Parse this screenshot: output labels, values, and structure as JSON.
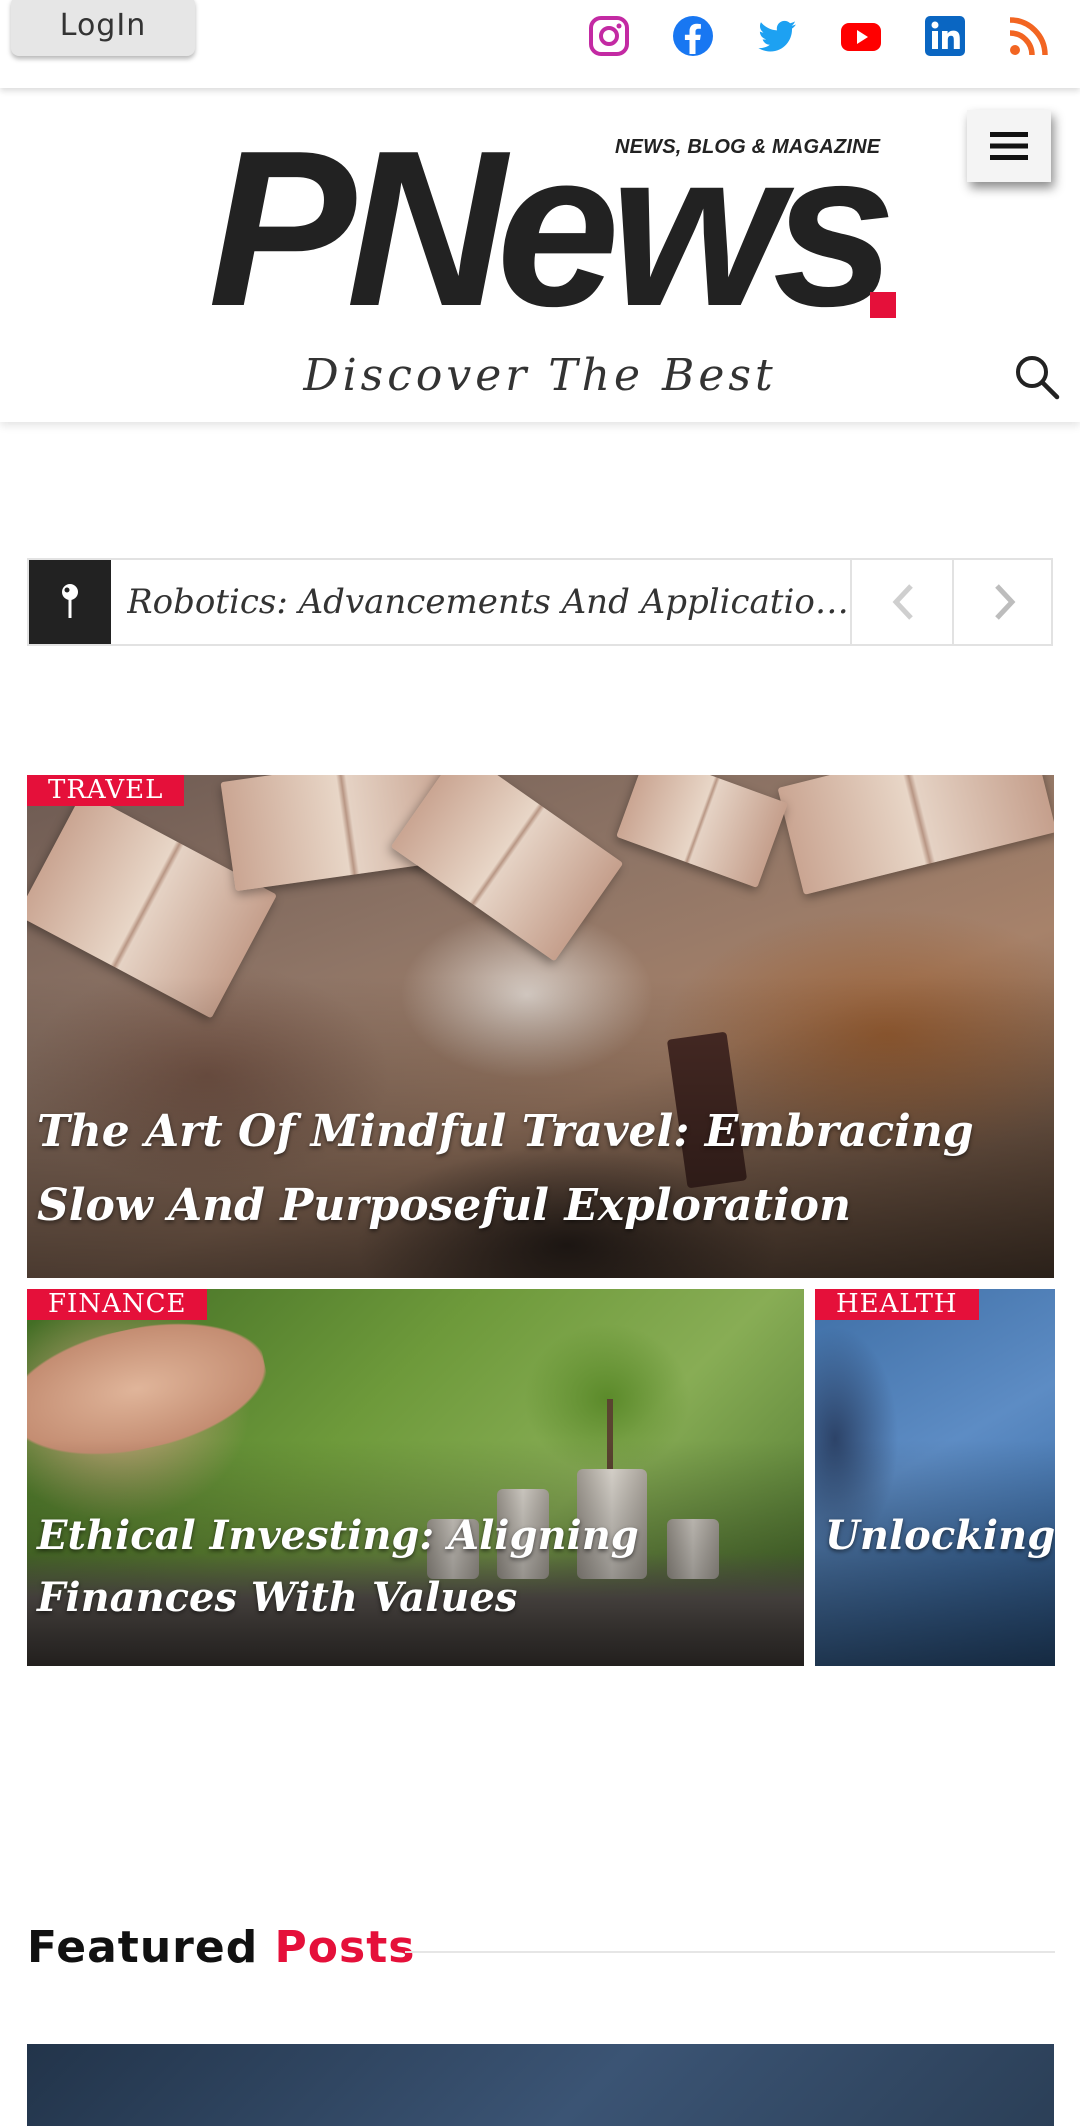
{
  "topbar": {
    "login_label": "LogIn",
    "social": [
      {
        "name": "instagram",
        "color": "#c32aa3"
      },
      {
        "name": "facebook",
        "color": "#1877f2"
      },
      {
        "name": "twitter",
        "color": "#1da1f2"
      },
      {
        "name": "youtube",
        "color": "#ff0000"
      },
      {
        "name": "linkedin",
        "color": "#0a66c2"
      },
      {
        "name": "rss",
        "color": "#f26522"
      }
    ]
  },
  "header": {
    "tagline": "NEWS, BLOG & MAGAZINE",
    "logo_text": "PNews",
    "slogan": "Discover The Best",
    "accent_color": "#e5103a"
  },
  "ticker": {
    "text": "Robotics: Advancements And Applications"
  },
  "posts": [
    {
      "category": "TRAVEL",
      "title": "The Art Of Mindful Travel: Embracing Slow And Purposeful Exploration"
    },
    {
      "category": "FINANCE",
      "title": "Ethical Investing: Aligning Finances With Values"
    },
    {
      "category": "HEALTH",
      "title": "Unlocking E… Of Sleep"
    }
  ],
  "featured": {
    "title_part1": "Featured",
    "title_part2": "Posts"
  }
}
